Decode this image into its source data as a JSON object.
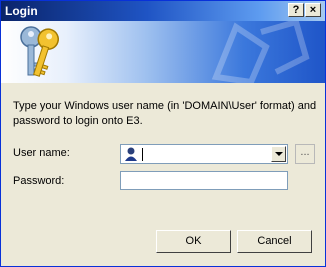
{
  "window": {
    "title": "Login",
    "help_glyph": "?",
    "close_glyph": "×"
  },
  "banner": {
    "icon": "keys-icon"
  },
  "prompt": {
    "text": "Type your Windows user name (in 'DOMAIN\\User' format) and password to login onto E3."
  },
  "form": {
    "username_label": "User name:",
    "username_value": "",
    "browse_label": "...",
    "password_label": "Password:",
    "password_value": ""
  },
  "buttons": {
    "ok": "OK",
    "cancel": "Cancel"
  },
  "colors": {
    "titlebar_start": "#0a246a",
    "titlebar_end": "#a6caf0",
    "dialog_bg": "#ece9d8",
    "field_border": "#7f9db9"
  }
}
